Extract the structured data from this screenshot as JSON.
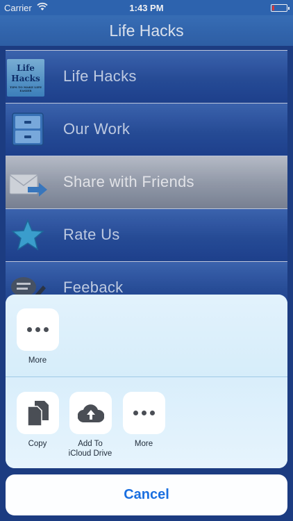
{
  "status_bar": {
    "carrier": "Carrier",
    "time": "1:43 PM"
  },
  "nav": {
    "title": "Life Hacks"
  },
  "menu": {
    "items": [
      {
        "label": "Life Hacks",
        "icon": "life-hacks-logo-icon"
      },
      {
        "label": "Our Work",
        "icon": "cabinet-icon"
      },
      {
        "label": "Share with Friends",
        "icon": "envelope-arrow-icon"
      },
      {
        "label": "Rate Us",
        "icon": "star-icon"
      },
      {
        "label": "Feeback",
        "icon": "speech-bubble-pencil-icon"
      }
    ],
    "logo_text": {
      "line1": "Life",
      "line2": "Hacks",
      "line3": "TIPS TO MAKE LIFE EASIER"
    }
  },
  "share_sheet": {
    "row1": [
      {
        "label": "More",
        "icon": "more-dots-icon"
      }
    ],
    "row2": [
      {
        "label": "Copy",
        "icon": "copy-icon"
      },
      {
        "label_line1": "Add To",
        "label_line2": "iCloud Drive",
        "icon": "icloud-upload-icon"
      },
      {
        "label": "More",
        "icon": "more-dots-icon"
      }
    ],
    "cancel_label": "Cancel"
  },
  "colors": {
    "accent": "#1a6fe0",
    "nav": "#2f63ac",
    "row": "#284f9c"
  }
}
